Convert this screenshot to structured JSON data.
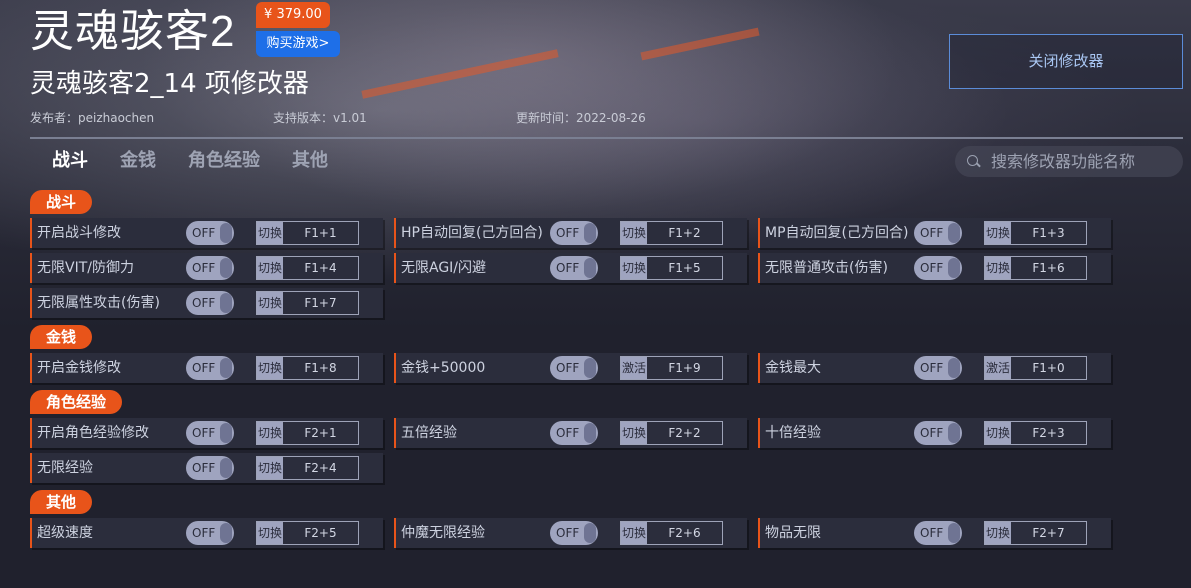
{
  "header": {
    "game_title": "灵魂骇客2",
    "price": "¥ 379.00",
    "buy_label": "购买游戏>",
    "trainer_title": "灵魂骇客2_14 项修改器",
    "publisher": "发布者：peizhaochen",
    "version": "支持版本：v1.01",
    "updated": "更新时间：2022-08-26",
    "close_label": "关闭修改器"
  },
  "tabs": [
    "战斗",
    "金钱",
    "角色经验",
    "其他"
  ],
  "search": {
    "placeholder": "搜索修改器功能名称"
  },
  "colors": {
    "accent": "#e8541a",
    "buy": "#1e6fe8",
    "toggle": "#9fa4bf"
  },
  "toggle_state": "OFF",
  "sections": [
    {
      "title": "战斗",
      "items": [
        {
          "label": "开启战斗修改",
          "type": "切换",
          "key": "F1+1"
        },
        {
          "label": "HP自动回复(己方回合)",
          "type": "切换",
          "key": "F1+2"
        },
        {
          "label": "MP自动回复(己方回合)",
          "type": "切换",
          "key": "F1+3"
        },
        {
          "label": "无限VIT/防御力",
          "type": "切换",
          "key": "F1+4"
        },
        {
          "label": "无限AGI/闪避",
          "type": "切换",
          "key": "F1+5"
        },
        {
          "label": "无限普通攻击(伤害)",
          "type": "切换",
          "key": "F1+6"
        },
        {
          "label": "无限属性攻击(伤害)",
          "type": "切换",
          "key": "F1+7"
        }
      ]
    },
    {
      "title": "金钱",
      "items": [
        {
          "label": "开启金钱修改",
          "type": "切换",
          "key": "F1+8"
        },
        {
          "label": "金钱+50000",
          "type": "激活",
          "key": "F1+9"
        },
        {
          "label": "金钱最大",
          "type": "激活",
          "key": "F1+0"
        }
      ]
    },
    {
      "title": "角色经验",
      "items": [
        {
          "label": "开启角色经验修改",
          "type": "切换",
          "key": "F2+1"
        },
        {
          "label": "五倍经验",
          "type": "切换",
          "key": "F2+2"
        },
        {
          "label": "十倍经验",
          "type": "切换",
          "key": "F2+3"
        },
        {
          "label": "无限经验",
          "type": "切换",
          "key": "F2+4"
        }
      ]
    },
    {
      "title": "其他",
      "items": [
        {
          "label": "超级速度",
          "type": "切换",
          "key": "F2+5"
        },
        {
          "label": "仲魔无限经验",
          "type": "切换",
          "key": "F2+6"
        },
        {
          "label": "物品无限",
          "type": "切换",
          "key": "F2+7"
        }
      ]
    }
  ]
}
